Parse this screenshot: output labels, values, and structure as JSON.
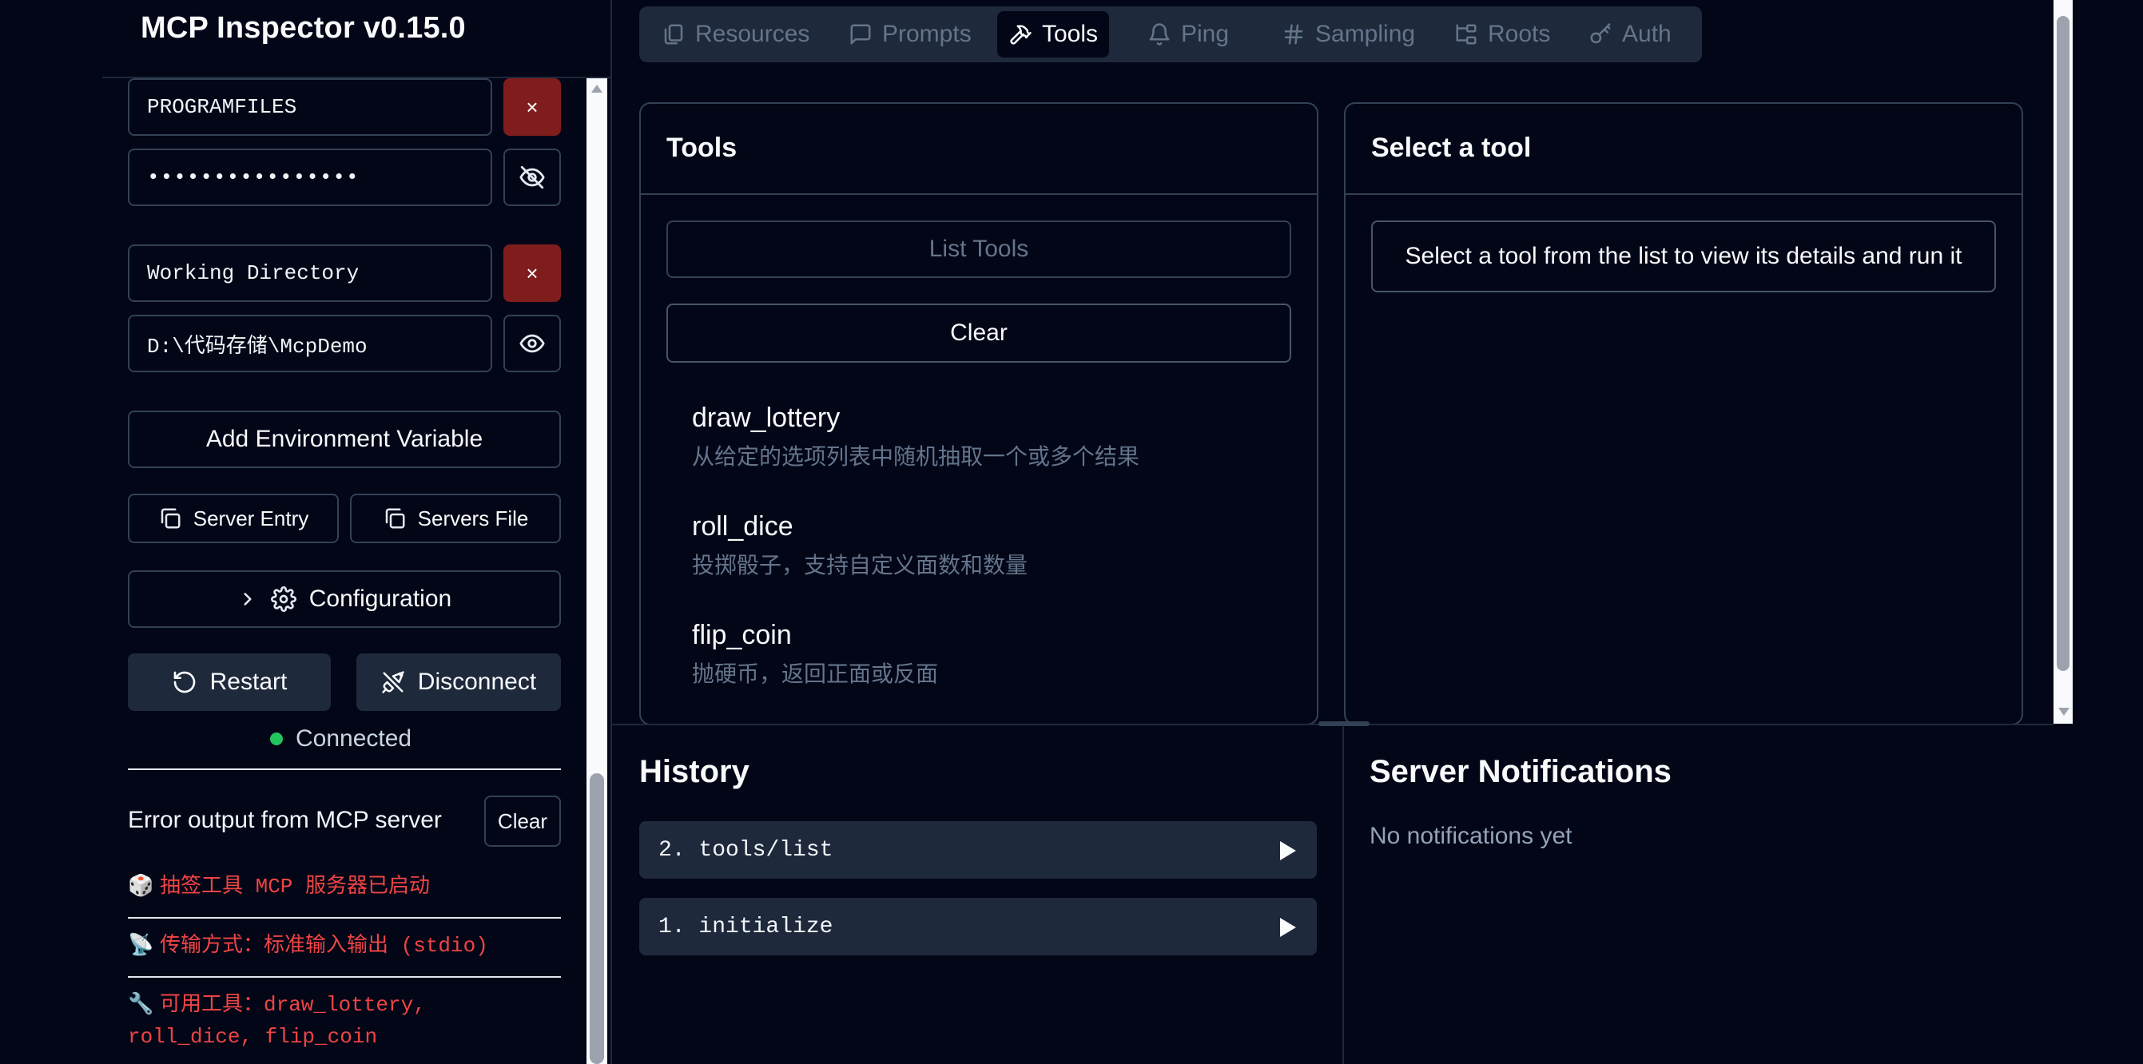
{
  "app": {
    "title": "MCP Inspector v0.15.0"
  },
  "sidebar": {
    "env_vars": [
      {
        "key": "PROGRAMFILES",
        "value": "••••••••••••••••"
      },
      {
        "key": "Working Directory",
        "value": "D:\\代码存储\\McpDemo"
      }
    ],
    "remove_glyph": "×",
    "add_env_label": "Add Environment Variable",
    "server_entry_label": "Server Entry",
    "servers_file_label": "Servers File",
    "configuration_label": "Configuration",
    "restart_label": "Restart",
    "disconnect_label": "Disconnect",
    "status_text": "Connected",
    "status_color": "#22c55e",
    "error_output_label": "Error output from MCP server",
    "error_clear_label": "Clear",
    "logs": [
      {
        "icon": "🎲",
        "text": "抽签工具 MCP 服务器已启动"
      },
      {
        "icon": "📡",
        "text": "传输方式：标准输入输出 (stdio)"
      },
      {
        "icon": "🔧",
        "text": "可用工具：draw_lottery, roll_dice, flip_coin"
      }
    ]
  },
  "tabs": [
    {
      "label": "Resources",
      "icon": "resources-icon"
    },
    {
      "label": "Prompts",
      "icon": "message-icon"
    },
    {
      "label": "Tools",
      "icon": "hammer-icon",
      "active": true
    },
    {
      "label": "Ping",
      "icon": "bell-icon"
    },
    {
      "label": "Sampling",
      "icon": "hash-icon"
    },
    {
      "label": "Roots",
      "icon": "folder-tree-icon"
    },
    {
      "label": "Auth",
      "icon": "key-icon"
    }
  ],
  "tools_panel": {
    "title": "Tools",
    "list_tools_label": "List Tools",
    "clear_label": "Clear",
    "tools": [
      {
        "name": "draw_lottery",
        "description": "从给定的选项列表中随机抽取一个或多个结果"
      },
      {
        "name": "roll_dice",
        "description": "投掷骰子，支持自定义面数和数量"
      },
      {
        "name": "flip_coin",
        "description": "抛硬币，返回正面或反面"
      }
    ]
  },
  "detail_panel": {
    "title": "Select a tool",
    "message": "Select a tool from the list to view its details and run it"
  },
  "history": {
    "title": "History",
    "items": [
      "2. tools/list",
      "1. initialize"
    ]
  },
  "notifications": {
    "title": "Server Notifications",
    "empty_text": "No notifications yet"
  }
}
